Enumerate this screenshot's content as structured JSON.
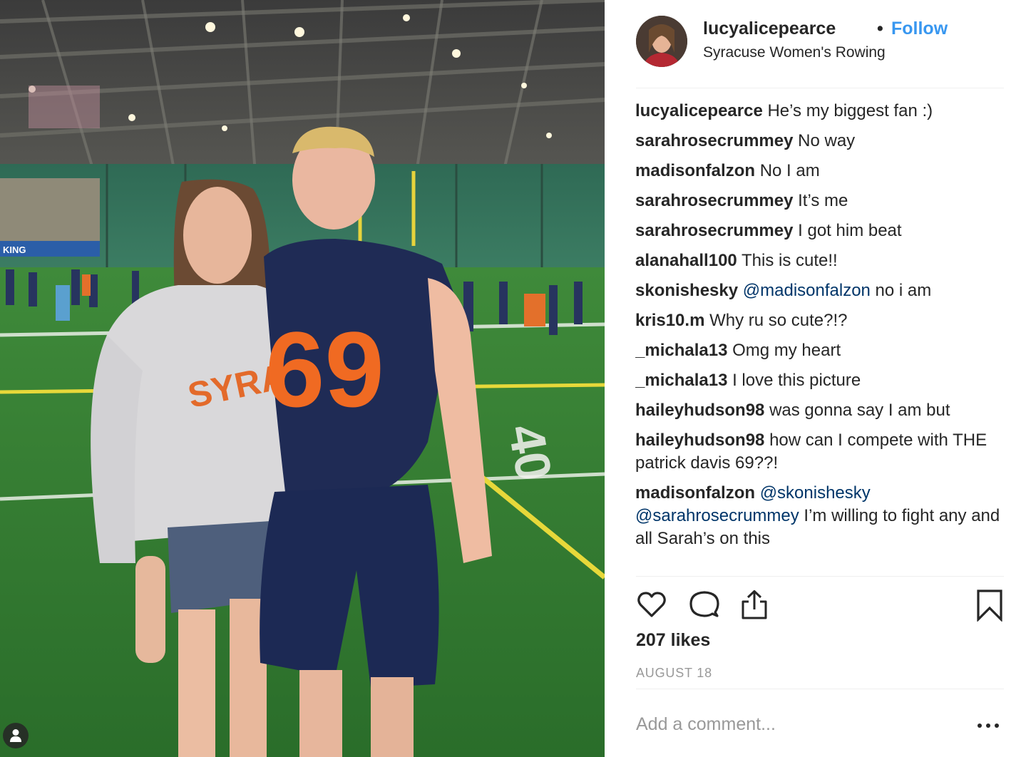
{
  "colors": {
    "link": "#3897f0",
    "mention": "#003569",
    "text": "#262626",
    "muted": "#999999",
    "jersey_navy": "#1d2a52",
    "jersey_orange": "#f36b21",
    "turf": "#2f7a2d"
  },
  "photo": {
    "sweatshirt_text": "SYRACU",
    "jersey_number": "69",
    "banner_text": "KING",
    "field_number": "40",
    "tag_icon": "person-tag-icon"
  },
  "header": {
    "username": "lucyalicepearce",
    "separator": "•",
    "follow_label": "Follow",
    "location": "Syracuse Women's Rowing"
  },
  "comments": [
    {
      "user": "lucyalicepearce",
      "parts": [
        {
          "t": "text",
          "v": "He’s my biggest fan :)"
        }
      ]
    },
    {
      "user": "sarahrosecrummey",
      "parts": [
        {
          "t": "text",
          "v": "No way"
        }
      ]
    },
    {
      "user": "madisonfalzon",
      "parts": [
        {
          "t": "text",
          "v": "No I am"
        }
      ]
    },
    {
      "user": "sarahrosecrummey",
      "parts": [
        {
          "t": "text",
          "v": "It’s me"
        }
      ]
    },
    {
      "user": "sarahrosecrummey",
      "parts": [
        {
          "t": "text",
          "v": "I got him beat"
        }
      ]
    },
    {
      "user": "alanahall100",
      "parts": [
        {
          "t": "text",
          "v": "This is cute!!"
        }
      ]
    },
    {
      "user": "skonishesky",
      "parts": [
        {
          "t": "mention",
          "v": "@madisonfalzon"
        },
        {
          "t": "text",
          "v": " no i am"
        }
      ]
    },
    {
      "user": "kris10.m",
      "parts": [
        {
          "t": "text",
          "v": "Why ru so cute?!?"
        }
      ]
    },
    {
      "user": "_michala13",
      "parts": [
        {
          "t": "text",
          "v": "Omg my heart"
        }
      ]
    },
    {
      "user": "_michala13",
      "parts": [
        {
          "t": "text",
          "v": "I love this picture"
        }
      ]
    },
    {
      "user": "haileyhudson98",
      "parts": [
        {
          "t": "text",
          "v": "was gonna say I am but"
        }
      ]
    },
    {
      "user": "haileyhudson98",
      "parts": [
        {
          "t": "text",
          "v": "how can I compete with THE patrick davis 69??!"
        }
      ]
    },
    {
      "user": "madisonfalzon",
      "parts": [
        {
          "t": "mention",
          "v": "@skonishesky"
        },
        {
          "t": "text",
          "v": " "
        },
        {
          "t": "mention",
          "v": "@sarahrosecrummey"
        },
        {
          "t": "text",
          "v": " I’m willing to fight any and all Sarah’s on this"
        }
      ]
    }
  ],
  "actions": {
    "like_icon": "heart-icon",
    "comment_icon": "comment-bubble-icon",
    "share_icon": "share-icon",
    "save_icon": "bookmark-icon"
  },
  "likes_text": "207 likes",
  "date_text": "AUGUST 18",
  "add_comment_placeholder": "Add a comment...",
  "more_icon": "more-options-icon"
}
